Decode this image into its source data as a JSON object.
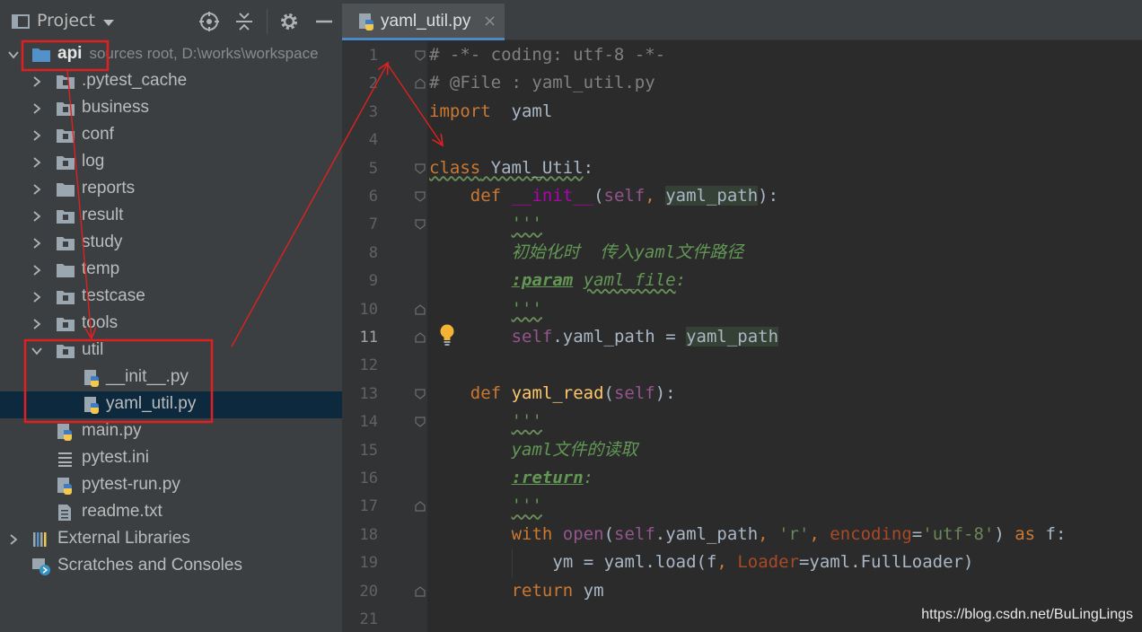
{
  "project_panel": {
    "title": "Project"
  },
  "tree": [
    {
      "label": "api",
      "extra": "sources root,  D:\\works\\workspace",
      "arrow": "down",
      "icon": "folder-blue-icon",
      "level": 0
    },
    {
      "label": ".pytest_cache",
      "arrow": "right",
      "icon": "package-folder-icon",
      "level": 1
    },
    {
      "label": "business",
      "arrow": "right",
      "icon": "package-folder-icon",
      "level": 1
    },
    {
      "label": "conf",
      "arrow": "right",
      "icon": "package-folder-icon",
      "level": 1
    },
    {
      "label": "log",
      "arrow": "right",
      "icon": "package-folder-icon",
      "level": 1
    },
    {
      "label": "reports",
      "arrow": "right",
      "icon": "folder-icon",
      "level": 1
    },
    {
      "label": "result",
      "arrow": "right",
      "icon": "package-folder-icon",
      "level": 1
    },
    {
      "label": "study",
      "arrow": "right",
      "icon": "package-folder-icon",
      "level": 1
    },
    {
      "label": "temp",
      "arrow": "right",
      "icon": "folder-icon",
      "level": 1
    },
    {
      "label": "testcase",
      "arrow": "right",
      "icon": "package-folder-icon",
      "level": 1
    },
    {
      "label": "tools",
      "arrow": "right",
      "icon": "package-folder-icon",
      "level": 1
    },
    {
      "label": "util",
      "arrow": "down",
      "icon": "package-folder-icon",
      "level": 1
    },
    {
      "label": "__init__.py",
      "arrow": "",
      "icon": "python-file-icon",
      "level": 2
    },
    {
      "label": "yaml_util.py",
      "arrow": "",
      "icon": "python-file-icon",
      "level": 2,
      "selected": true
    },
    {
      "label": "main.py",
      "arrow": "",
      "icon": "python-file-icon",
      "level": 1
    },
    {
      "label": "pytest.ini",
      "arrow": "",
      "icon": "ini-file-icon",
      "level": 1
    },
    {
      "label": "pytest-run.py",
      "arrow": "",
      "icon": "python-file-icon",
      "level": 1
    },
    {
      "label": "readme.txt",
      "arrow": "",
      "icon": "text-file-icon",
      "level": 1
    },
    {
      "label": "External Libraries",
      "arrow": "right",
      "icon": "libraries-icon",
      "level": 0
    },
    {
      "label": "Scratches and Consoles",
      "arrow": "",
      "icon": "scratches-icon",
      "level": 0
    }
  ],
  "editor": {
    "tab_label": "yaml_util.py",
    "tab_close": "×",
    "current_line": 11
  },
  "code_lines": [
    {
      "n": "1",
      "fold": "open",
      "indent": 0,
      "segs": [
        [
          "cm",
          "# -*- coding: utf-8 -*-"
        ]
      ]
    },
    {
      "n": "2",
      "fold": "close",
      "indent": 0,
      "segs": [
        [
          "cm",
          "# @File : yaml_util.py"
        ]
      ]
    },
    {
      "n": "3",
      "fold": "",
      "indent": 0,
      "segs": [
        [
          "kw",
          "import"
        ],
        [
          "",
          "  yaml"
        ]
      ]
    },
    {
      "n": "4",
      "fold": "",
      "indent": 0,
      "segs": []
    },
    {
      "n": "5",
      "fold": "open",
      "indent": 0,
      "segs": [
        [
          "kw wavy",
          "class"
        ],
        [
          "wavy",
          " Yaml_Util"
        ],
        [
          "",
          ":"
        ]
      ]
    },
    {
      "n": "6",
      "fold": "open",
      "indent": 4,
      "segs": [
        [
          "kw",
          "def "
        ],
        [
          "mg",
          "__init__"
        ],
        [
          "",
          "("
        ],
        [
          "sf",
          "self"
        ],
        [
          "kw",
          ", "
        ],
        [
          "hl",
          "yaml_path"
        ],
        [
          "",
          "):"
        ]
      ]
    },
    {
      "n": "7",
      "fold": "open",
      "indent": 8,
      "segs": [
        [
          "doc wavy",
          "'''"
        ]
      ]
    },
    {
      "n": "8",
      "fold": "",
      "indent": 8,
      "segs": [
        [
          "doc",
          "初始化时  传入yaml文件路径"
        ]
      ]
    },
    {
      "n": "9",
      "fold": "",
      "indent": 8,
      "segs": [
        [
          "doctag",
          ":param"
        ],
        [
          "doc",
          " "
        ],
        [
          "docw",
          "yaml_file"
        ],
        [
          "doc",
          ":"
        ]
      ]
    },
    {
      "n": "10",
      "fold": "close",
      "indent": 8,
      "segs": [
        [
          "doc wavy",
          "'''"
        ]
      ]
    },
    {
      "n": "11",
      "fold": "close",
      "indent": 8,
      "segs": [
        [
          "sf",
          "self"
        ],
        [
          "",
          ".yaml_path = "
        ],
        [
          "hl",
          "yaml_path"
        ]
      ]
    },
    {
      "n": "12",
      "fold": "",
      "indent": 0,
      "segs": []
    },
    {
      "n": "13",
      "fold": "open",
      "indent": 4,
      "segs": [
        [
          "kw",
          "def "
        ],
        [
          "fn",
          "yaml_read"
        ],
        [
          "",
          "("
        ],
        [
          "sf",
          "self"
        ],
        [
          "",
          "):"
        ]
      ]
    },
    {
      "n": "14",
      "fold": "open",
      "indent": 8,
      "segs": [
        [
          "doc wavy",
          "'''"
        ]
      ]
    },
    {
      "n": "15",
      "fold": "",
      "indent": 8,
      "segs": [
        [
          "doc",
          "yaml文件的读取"
        ]
      ]
    },
    {
      "n": "16",
      "fold": "",
      "indent": 8,
      "segs": [
        [
          "doctag",
          ":return"
        ],
        [
          "doc",
          ":"
        ]
      ]
    },
    {
      "n": "17",
      "fold": "close",
      "indent": 8,
      "segs": [
        [
          "doc wavy",
          "'''"
        ]
      ]
    },
    {
      "n": "18",
      "fold": "",
      "indent": 8,
      "segs": [
        [
          "kw",
          "with "
        ],
        [
          "bi",
          "open"
        ],
        [
          "",
          "("
        ],
        [
          "sf",
          "self"
        ],
        [
          "",
          ".yaml_path"
        ],
        [
          "kw",
          ", "
        ],
        [
          "st",
          "'r'"
        ],
        [
          "kw",
          ", "
        ],
        [
          "kwa",
          "encoding"
        ],
        [
          "",
          "="
        ],
        [
          "st",
          "'utf-8'"
        ],
        [
          "",
          ") "
        ],
        [
          "kw",
          "as"
        ],
        [
          "",
          "",
          " f:"
        ]
      ]
    },
    {
      "n": "19",
      "fold": "",
      "indent": 12,
      "segs": [
        [
          "",
          "ym = yaml.load(f"
        ],
        [
          "kw",
          ", "
        ],
        [
          "kwa",
          "Loader"
        ],
        [
          "",
          "=yaml.FullLoader)"
        ]
      ]
    },
    {
      "n": "20",
      "fold": "close",
      "indent": 8,
      "segs": [
        [
          "kw",
          "return"
        ],
        [
          "",
          "",
          " ym"
        ]
      ]
    },
    {
      "n": "21",
      "fold": "",
      "indent": 0,
      "segs": []
    }
  ],
  "watermark": "https://blog.csdn.net/BuLingLings",
  "colors": {
    "panel_bg": "#3c3f41",
    "editor_bg": "#2b2b2b",
    "selection": "#0d293e",
    "annotation_red": "#e02020",
    "tab_underline": "#4a88c7"
  }
}
